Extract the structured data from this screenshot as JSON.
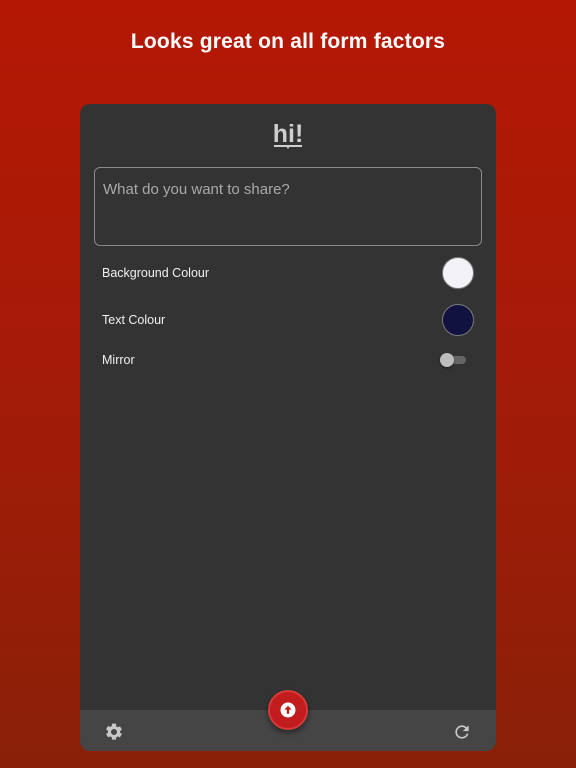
{
  "headline": "Looks great on all form factors",
  "app": {
    "logo_text": "hi!"
  },
  "compose": {
    "placeholder": "What do you want to share?",
    "value": ""
  },
  "settings": {
    "background_colour": {
      "label": "Background Colour",
      "color": "#f2f2f7"
    },
    "text_colour": {
      "label": "Text Colour",
      "color": "#121240"
    },
    "mirror": {
      "label": "Mirror",
      "enabled": false
    }
  },
  "toolbar": {
    "settings_icon": "gear-icon",
    "share_icon": "arrow-up-circle-icon",
    "reset_icon": "refresh-icon"
  },
  "colors": {
    "brand": "#b41804",
    "panel": "#333333",
    "fab": "#c11d1d"
  }
}
